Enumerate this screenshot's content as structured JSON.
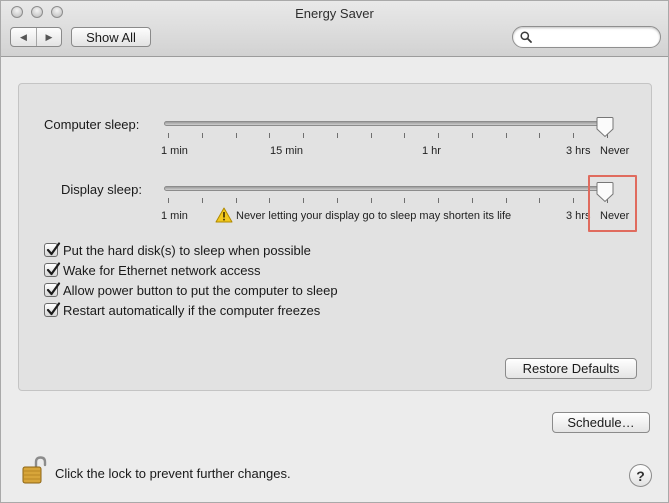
{
  "window": {
    "title": "Energy Saver"
  },
  "toolbar": {
    "back_icon": "back-arrow-icon",
    "forward_icon": "forward-arrow-icon",
    "back_glyph": "◀",
    "forward_glyph": "▶",
    "show_all_label": "Show All",
    "search_placeholder": "",
    "search_value": ""
  },
  "computer_sleep": {
    "label": "Computer sleep:",
    "ticks": [
      "1 min",
      "15 min",
      "1 hr",
      "3 hrs",
      "Never"
    ],
    "value": "Never"
  },
  "display_sleep": {
    "label": "Display sleep:",
    "ticks": [
      "1 min",
      "3 hrs",
      "Never"
    ],
    "value": "Never",
    "warning": "Never letting your display go to sleep may shorten its life"
  },
  "options": [
    {
      "label": "Put the hard disk(s) to sleep when possible",
      "checked": true
    },
    {
      "label": "Wake for Ethernet network access",
      "checked": true
    },
    {
      "label": "Allow power button to put the computer to sleep",
      "checked": true
    },
    {
      "label": "Restart automatically if the computer freezes",
      "checked": true
    }
  ],
  "buttons": {
    "restore_defaults": "Restore Defaults",
    "schedule": "Schedule…",
    "help": "?"
  },
  "lock": {
    "text": "Click the lock to prevent further changes.",
    "icon": "lock-open-icon"
  },
  "colors": {
    "highlight": "#e06b5e",
    "warning": "#f2c81c"
  }
}
